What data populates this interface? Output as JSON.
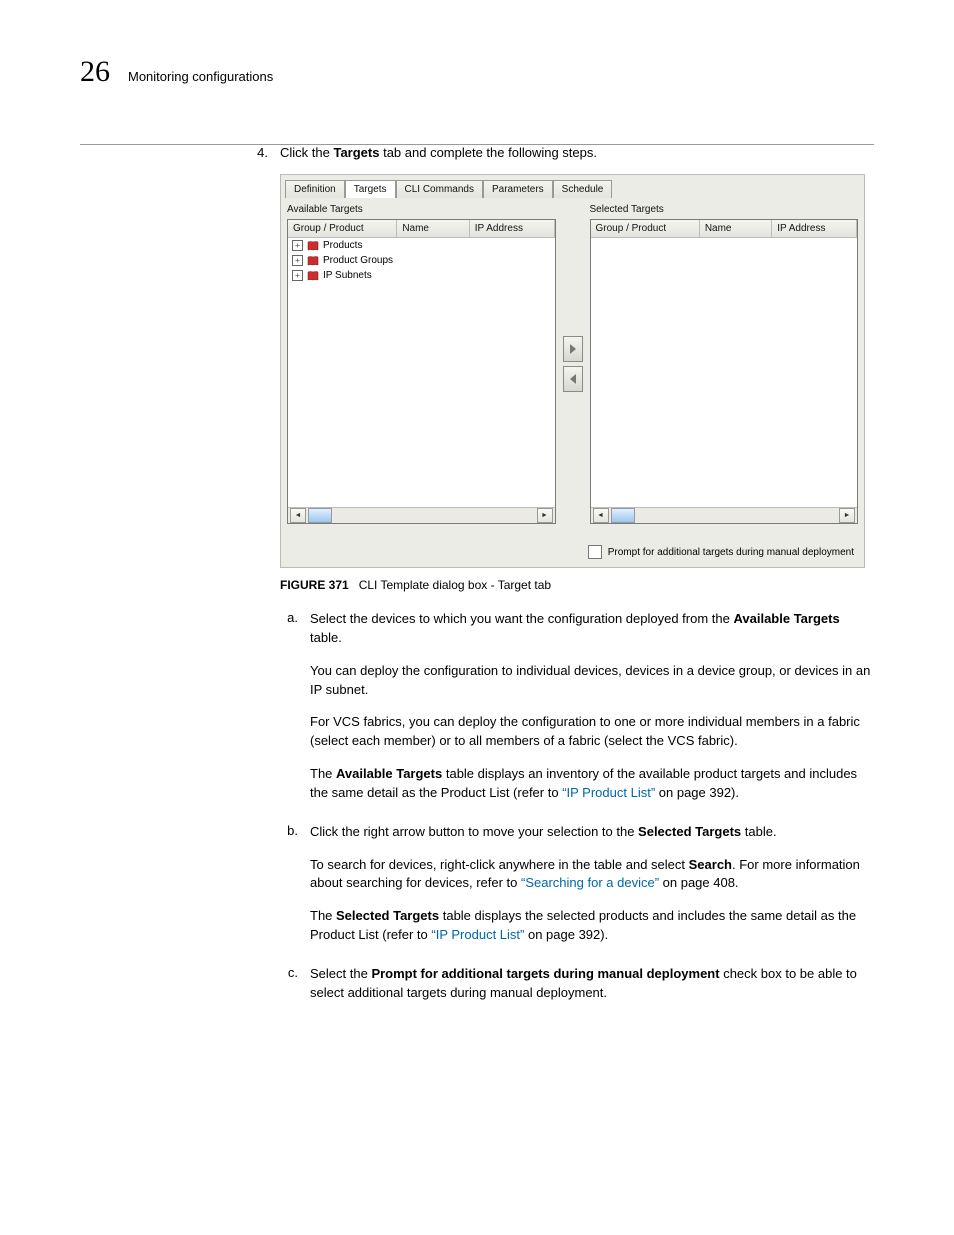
{
  "chapter_number": "26",
  "chapter_title": "Monitoring configurations",
  "step": {
    "number": "4.",
    "pre_text": "Click the ",
    "bold1": "Targets",
    "post_text": " tab and complete the following steps."
  },
  "dialog": {
    "tabs": [
      "Definition",
      "Targets",
      "CLI Commands",
      "Parameters",
      "Schedule"
    ],
    "available_title": "Available Targets",
    "selected_title": "Selected Targets",
    "columns": {
      "group": "Group / Product",
      "name": "Name",
      "ip": "IP Address"
    },
    "tree": {
      "products": "Products",
      "product_groups": "Product Groups",
      "ip_subnets": "IP Subnets"
    },
    "checkbox_label": "Prompt for additional targets during manual deployment"
  },
  "figure_caption": {
    "label": "FIGURE 371",
    "text": "CLI Template dialog box - Target tab"
  },
  "sub": {
    "a": {
      "letter": "a.",
      "p1_pre": "Select the devices to which you want the configuration deployed from the ",
      "p1_bold": "Available Targets",
      "p1_post": " table.",
      "p2": "You can deploy the configuration to individual devices, devices in a device group, or devices in an IP subnet.",
      "p3": "For VCS fabrics, you can deploy the configuration to one or more individual members in a fabric (select each member) or to all members of a fabric (select the VCS fabric).",
      "p4_pre": "The ",
      "p4_bold": "Available Targets",
      "p4_mid": " table displays an inventory of the available product targets and includes the same detail as the Product List (refer to ",
      "p4_link": "“IP Product List”",
      "p4_end": " on page 392)."
    },
    "b": {
      "letter": "b.",
      "p1_pre": "Click the right arrow button to move your selection to the ",
      "p1_bold": "Selected Targets",
      "p1_post": " table.",
      "p2_pre": "To search for devices, right-click anywhere in the table and select ",
      "p2_bold": "Search",
      "p2_mid": ". For more information about searching for devices, refer to ",
      "p2_link": "“Searching for a device”",
      "p2_end": " on page 408.",
      "p3_pre": "The ",
      "p3_bold": "Selected Targets",
      "p3_mid": " table displays the selected products and includes the same detail as the Product List (refer to ",
      "p3_link": "“IP Product List”",
      "p3_end": " on page 392)."
    },
    "c": {
      "letter": "c.",
      "p1_pre": "Select the ",
      "p1_bold": "Prompt for additional targets during manual deployment",
      "p1_post": " check box to be able to select additional targets during manual deployment."
    }
  }
}
